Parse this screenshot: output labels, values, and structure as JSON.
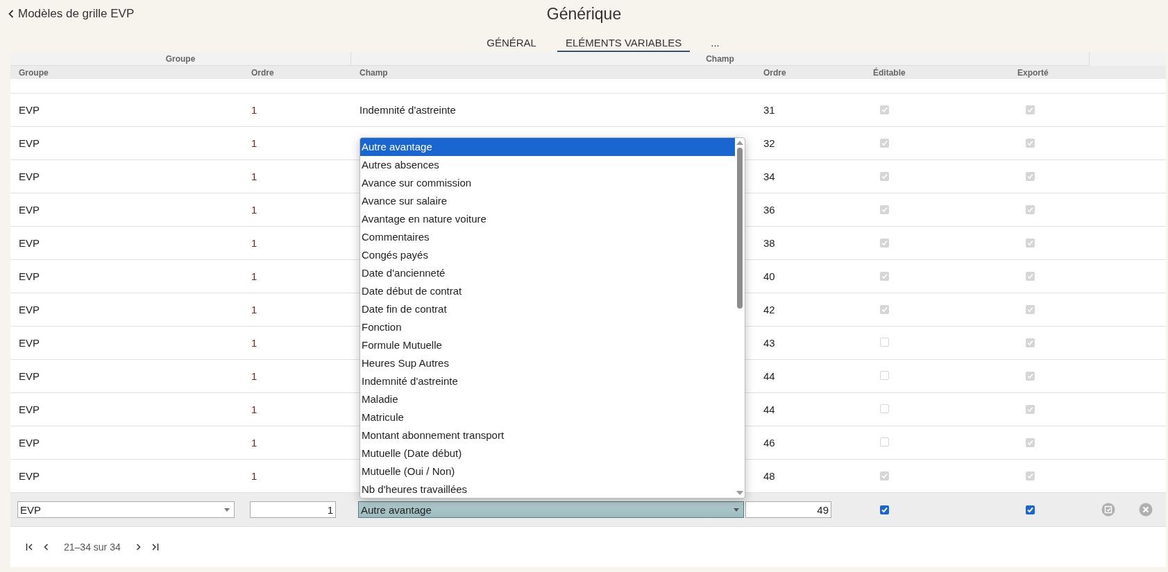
{
  "back": {
    "label": "Modèles de grille EVP"
  },
  "title": "Générique",
  "tabs": [
    {
      "label": "GÉNÉRAL",
      "selected": false
    },
    {
      "label": "ELÉMENTS VARIABLES",
      "selected": true
    },
    {
      "label": "...",
      "selected": false
    }
  ],
  "table": {
    "group_headers": [
      "Groupe",
      "Champ"
    ],
    "columns": [
      "Groupe",
      "Ordre",
      "Champ",
      "Ordre",
      "Éditable",
      "Exporté"
    ],
    "rows": [
      {
        "groupe": "EVP",
        "ordre": "1",
        "champ": "Indemnité d'astreinte",
        "champ_ordre": "31",
        "editable": true,
        "exported": true
      },
      {
        "groupe": "EVP",
        "ordre": "1",
        "champ_ordre": "32",
        "editable": true,
        "exported": true
      },
      {
        "groupe": "EVP",
        "ordre": "1",
        "champ_ordre": "34",
        "editable": true,
        "exported": true
      },
      {
        "groupe": "EVP",
        "ordre": "1",
        "champ_ordre": "36",
        "editable": true,
        "exported": true
      },
      {
        "groupe": "EVP",
        "ordre": "1",
        "champ_ordre": "38",
        "editable": true,
        "exported": true
      },
      {
        "groupe": "EVP",
        "ordre": "1",
        "champ_ordre": "40",
        "editable": true,
        "exported": true
      },
      {
        "groupe": "EVP",
        "ordre": "1",
        "champ_ordre": "42",
        "editable": true,
        "exported": true
      },
      {
        "groupe": "EVP",
        "ordre": "1",
        "champ_ordre": "43",
        "editable": false,
        "exported": true
      },
      {
        "groupe": "EVP",
        "ordre": "1",
        "champ_ordre": "44",
        "editable": false,
        "exported": true
      },
      {
        "groupe": "EVP",
        "ordre": "1",
        "champ_ordre": "44",
        "editable": false,
        "exported": true
      },
      {
        "groupe": "EVP",
        "ordre": "1",
        "champ_ordre": "46",
        "editable": false,
        "exported": true
      },
      {
        "groupe": "EVP",
        "ordre": "1",
        "champ_ordre": "48",
        "editable": true,
        "exported": true
      }
    ],
    "edit_row": {
      "groupe": "EVP",
      "ordre": "1",
      "champ": "Autre avantage",
      "champ_ordre": "49",
      "editable": true,
      "exported": true
    },
    "dropdown": {
      "options": [
        {
          "label": "Autre avantage",
          "selected": true
        },
        {
          "label": "Autres absences",
          "selected": false
        },
        {
          "label": "Avance sur commission",
          "selected": false
        },
        {
          "label": "Avance sur salaire",
          "selected": false
        },
        {
          "label": "Avantage en nature voiture",
          "selected": false
        },
        {
          "label": "Commentaires",
          "selected": false
        },
        {
          "label": "Congés payés",
          "selected": false
        },
        {
          "label": "Date d'ancienneté",
          "selected": false
        },
        {
          "label": "Date début de contrat",
          "selected": false
        },
        {
          "label": "Date fin de contrat",
          "selected": false
        },
        {
          "label": "Fonction",
          "selected": false
        },
        {
          "label": "Formule Mutuelle",
          "selected": false
        },
        {
          "label": "Heures Sup Autres",
          "selected": false
        },
        {
          "label": "Indemnité d'astreinte",
          "selected": false
        },
        {
          "label": "Maladie",
          "selected": false
        },
        {
          "label": "Matricule",
          "selected": false
        },
        {
          "label": "Montant abonnement transport",
          "selected": false
        },
        {
          "label": "Mutuelle (Date début)",
          "selected": false
        },
        {
          "label": "Mutuelle (Oui / Non)",
          "selected": false
        },
        {
          "label": "Nb d'heures travaillées",
          "selected": false
        }
      ]
    }
  },
  "pagination": {
    "range": "21–34 sur 34"
  }
}
